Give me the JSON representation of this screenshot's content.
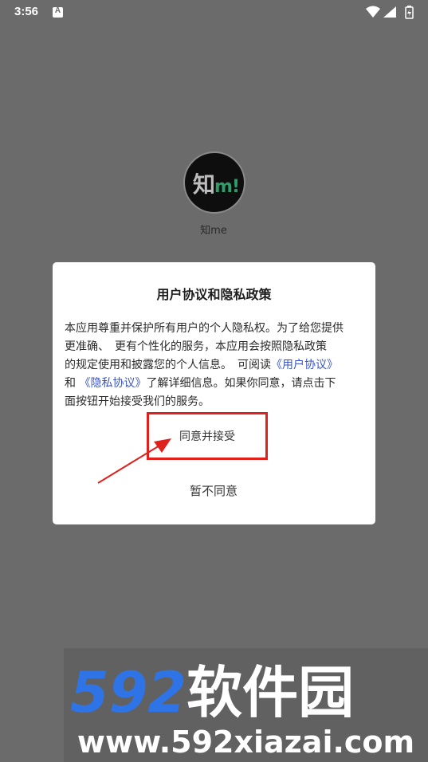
{
  "status_bar": {
    "time": "3:56",
    "notification_glyph": "A",
    "icons": [
      "wifi-icon",
      "signal-icon",
      "battery-icon"
    ]
  },
  "app": {
    "logo_text_zhi": "知",
    "logo_text_me": "m!",
    "name": "知me"
  },
  "dialog": {
    "title": "用户协议和隐私政策",
    "body_line1": "本应用尊重并保护所有用户的个人隐私权。为了给您提供",
    "body_line2": "更准确、　更有个性化的服务，本应用会按照隐私政策",
    "body_line3": "的规定使用和披露您的个人信息。　可阅读",
    "link_user_agreement": "《用户协议》",
    "body_and": "和",
    "link_privacy": "《隐私协议》",
    "body_line4": "了解详细信息。如果你同意，请点击下",
    "body_line5": "面按钮开始接受我们的服务。",
    "agree_label": "同意并接受",
    "disagree_label": "暂不同意"
  },
  "watermark": {
    "logo_text": "592软件园",
    "url": "www.592xiazai.com"
  },
  "colors": {
    "background_dim": "#6b6b6b",
    "link": "#3a55c9",
    "highlight_red": "#e0201b",
    "watermark_blue": "#2f74e6"
  }
}
